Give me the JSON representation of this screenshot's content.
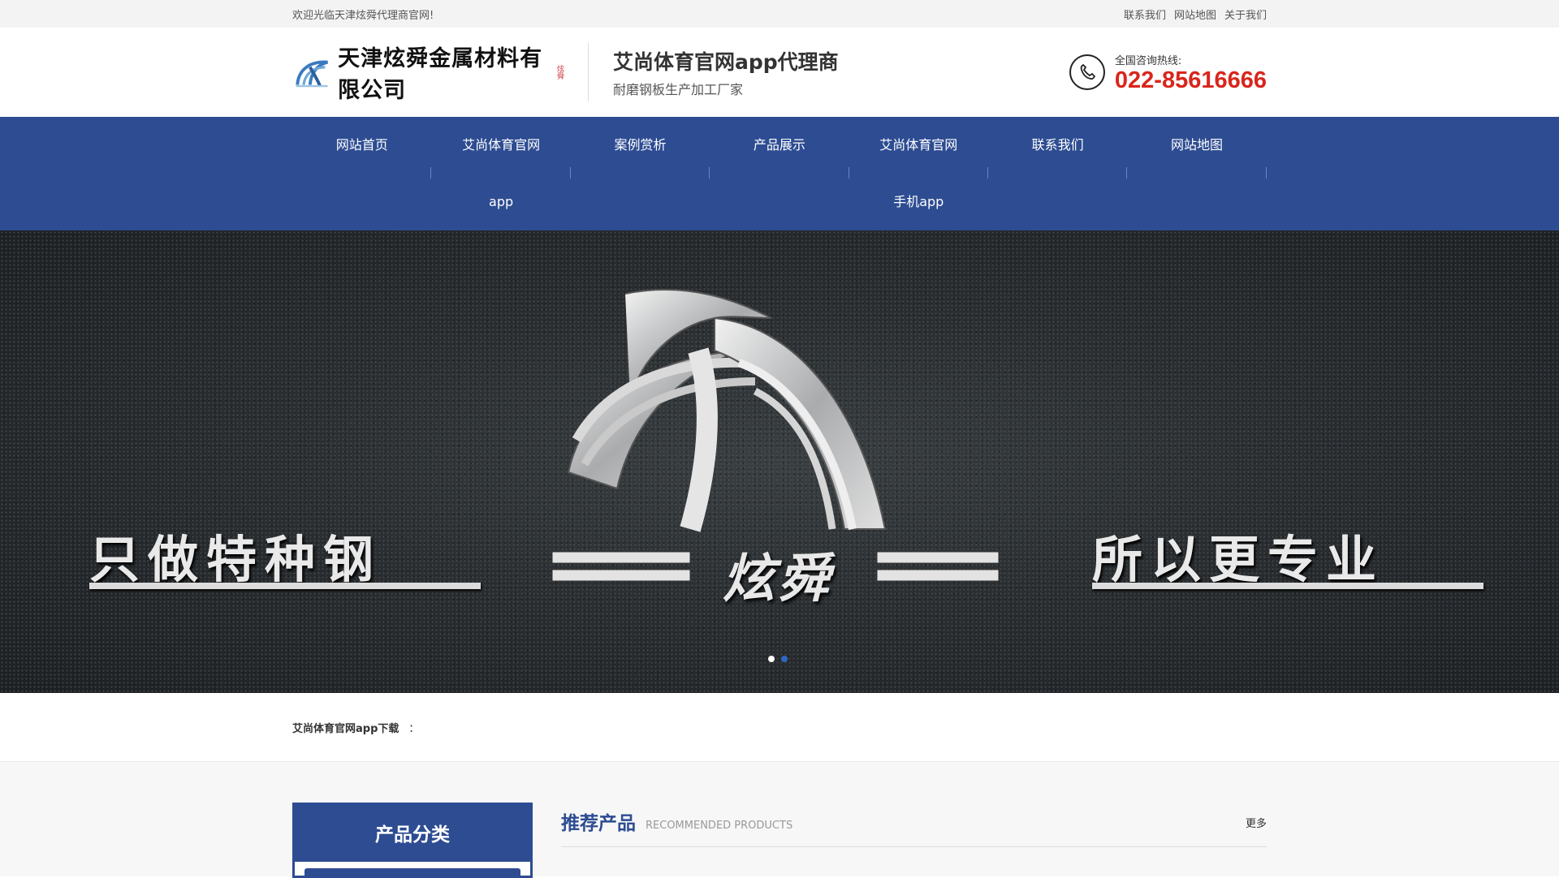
{
  "topbar": {
    "welcome": "欢迎光临天津炫舜代理商官网!",
    "links": [
      "联系我们",
      "网站地图",
      "关于我们"
    ]
  },
  "header": {
    "logo_text": "天津炫舜金属材料有限公司",
    "logo_seal": "炫舜",
    "slogan_title": "艾尚体育官网app代理商",
    "slogan_sub": "耐磨钢板生产加工厂家",
    "hotline_label": "全国咨询热线:",
    "hotline_number": "022-85616666",
    "phone_icon": "phone-icon"
  },
  "nav": {
    "items": [
      {
        "l1": "网站首页",
        "l2": ""
      },
      {
        "l1": "艾尚体育官网",
        "l2": "app"
      },
      {
        "l1": "案例赏析",
        "l2": ""
      },
      {
        "l1": "产品展示",
        "l2": ""
      },
      {
        "l1": "艾尚体育官网",
        "l2": "手机app"
      },
      {
        "l1": "联系我们",
        "l2": ""
      },
      {
        "l1": "网站地图",
        "l2": ""
      }
    ]
  },
  "banner": {
    "left_text": "只做特种钢",
    "brand_text": "炫舜",
    "right_text": "所以更专业",
    "slides": 2,
    "active_slide": 1
  },
  "notice": {
    "label": "艾尚体育官网app下载",
    "colon": "："
  },
  "sidebar": {
    "title": "产品分类"
  },
  "section": {
    "title": "推荐产品",
    "subtitle": "RECOMMENDED PRODUCTS",
    "more": "更多"
  },
  "colors": {
    "brand_blue": "#2d4c92",
    "hotline_red": "#d8261c",
    "dot_active": "#2d67c4"
  }
}
